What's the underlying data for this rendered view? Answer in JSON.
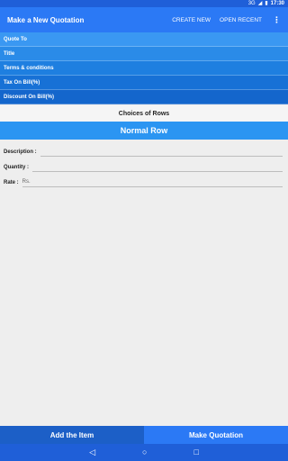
{
  "status_bar": {
    "network": "3G",
    "clock": "17:30"
  },
  "app_bar": {
    "title": "Make a New Quotation",
    "actions": [
      "CREATE NEW",
      "OPEN RECENT"
    ],
    "more_icon": "⋮"
  },
  "sections": [
    {
      "label": "Quote To"
    },
    {
      "label": "Title"
    },
    {
      "label": "Terms & conditions"
    },
    {
      "label": "Tax On Bill(%)"
    },
    {
      "label": "Discount On Bill(%)"
    }
  ],
  "choices_label": "Choices of Rows",
  "row_type": "Normal Row",
  "form": {
    "description_label": "Description :",
    "quantity_label": "Quantity :",
    "rate_label": "Rate :",
    "rate_prefix": "Rs."
  },
  "bottom_buttons": {
    "add_item": "Add the Item",
    "make_quotation": "Make Quotation"
  },
  "colors": {
    "app_bar": "#2b79f5",
    "status_bar": "#1f5fd8",
    "accent": "#2b95f2"
  },
  "nav_icons": [
    "back-icon",
    "home-icon",
    "recents-icon"
  ]
}
